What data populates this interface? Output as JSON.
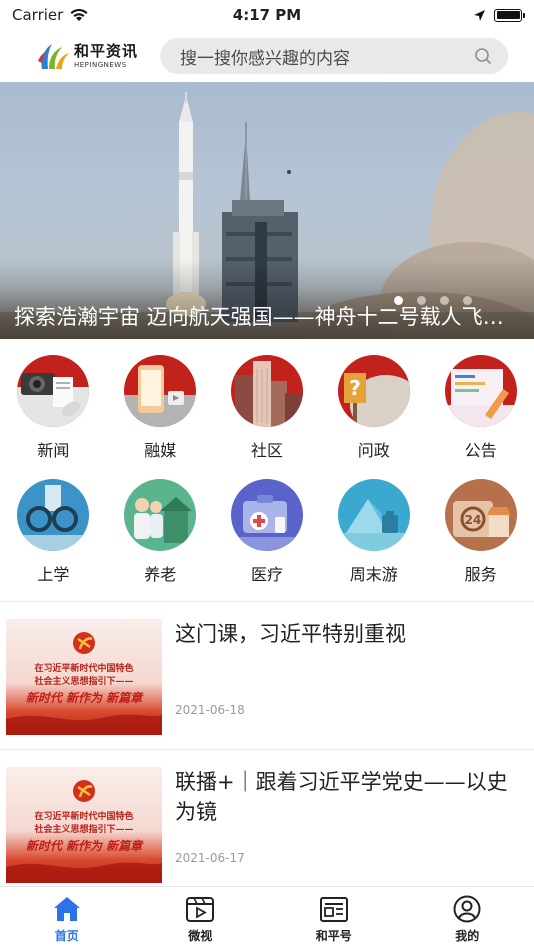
{
  "status_bar": {
    "carrier": "Carrier",
    "time": "4:17 PM"
  },
  "header": {
    "logo_cn": "和平资讯",
    "logo_en": "HEPINGNEWS",
    "search_placeholder": "搜一搜你感兴趣的内容"
  },
  "banner": {
    "title": "探索浩瀚宇宙 迈向航天强国——神舟十二号载人飞船发射成功",
    "dot_count": 4,
    "active_dot": 0
  },
  "categories": [
    {
      "label": "新闻",
      "icon": "news-icon"
    },
    {
      "label": "融媒",
      "icon": "media-icon"
    },
    {
      "label": "社区",
      "icon": "community-icon"
    },
    {
      "label": "问政",
      "icon": "inquiry-icon"
    },
    {
      "label": "公告",
      "icon": "notice-icon"
    },
    {
      "label": "上学",
      "icon": "school-icon"
    },
    {
      "label": "养老",
      "icon": "elderly-icon"
    },
    {
      "label": "医疗",
      "icon": "medical-icon"
    },
    {
      "label": "周末游",
      "icon": "weekend-trip-icon"
    },
    {
      "label": "服务",
      "icon": "service-icon"
    }
  ],
  "news": [
    {
      "title": "这门课，习近平特别重视",
      "date": "2021-06-18",
      "thumb_lines": [
        "在习近平新时代中国特色",
        "社会主义思想指引下——",
        "新时代 新作为 新篇章"
      ]
    },
    {
      "title": "联播+｜跟着习近平学党史——以史为镜",
      "date": "2021-06-17",
      "thumb_lines": [
        "在习近平新时代中国特色",
        "社会主义思想指引下——",
        "新时代 新作为 新篇章"
      ]
    }
  ],
  "tabbar": {
    "tabs": [
      {
        "label": "首页",
        "icon": "home-icon",
        "active": true
      },
      {
        "label": "微视",
        "icon": "video-icon",
        "active": false
      },
      {
        "label": "和平号",
        "icon": "newspaper-icon",
        "active": false
      },
      {
        "label": "我的",
        "icon": "profile-icon",
        "active": false
      }
    ]
  },
  "colors": {
    "accent": "#2a73e8",
    "thumb_red": "#c8221a"
  }
}
